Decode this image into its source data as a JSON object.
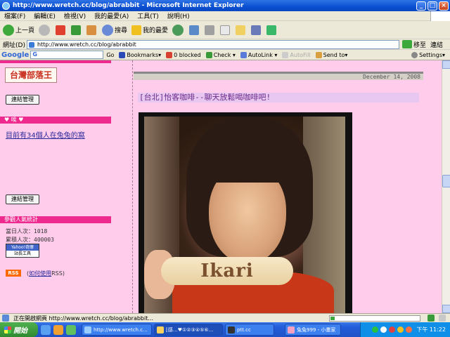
{
  "window": {
    "title": "http://www.wretch.cc/blog/abrabbit - Microsoft Internet Explorer",
    "min": "_",
    "max": "□",
    "close": "×"
  },
  "menu": [
    "檔案(F)",
    "編輯(E)",
    "檢視(V)",
    "我的最愛(A)",
    "工具(T)",
    "說明(H)"
  ],
  "toolbar": {
    "back": "上一頁",
    "search": "搜尋",
    "favorites": "我的最愛"
  },
  "address": {
    "label": "網址(D)",
    "url": "http://www.wretch.cc/blog/abrabbit",
    "go": "移至",
    "links": "連結"
  },
  "googlebar": {
    "logo": "Google",
    "search_placeholder": "G",
    "go": "Go",
    "bookmarks": "Bookmarks▾",
    "blocked": "0 blocked",
    "check": "Check ▾",
    "autolink": "AutoLink ▾",
    "autofill": "AutoFill",
    "sendto": "Send to▾",
    "settings": "Settings▾"
  },
  "sidebar": {
    "logo": "台灣部落王",
    "btn1": "連結管理",
    "header_visitors": "♥ 唉 ♥",
    "online_link": "目前有34個人在兔兔的窩",
    "btn2": "連結管理",
    "header_stats": "參觀人氣統計",
    "today_label": "當日人次：",
    "today_value": "1018",
    "total_label": "累積人次：",
    "total_value": "400003",
    "yahoo_top": "Yahoo!奇摩",
    "yahoo_bottom": "站長工具",
    "rss": "RSS",
    "rss_link_open": "(",
    "rss_link_text": "如何使用",
    "rss_link_close": "RSS)"
  },
  "content": {
    "date": "December 14, 2008",
    "post_title": "[台北]怡客咖啡--聊天放鬆喝咖啡吧!",
    "photo_text": "Ikari"
  },
  "status": {
    "text": "正在開啟網頁 http://www.wretch.cc/blog/abrabbit...",
    "progress": 0.05
  },
  "taskbar": {
    "start": "開始",
    "tasks": [
      "http://www.wretch.c...",
      "[感…♥①②③④⑤⑥...",
      "ptt.cc",
      "兔兔999 - 小畫家"
    ],
    "clock": "下午 11:22"
  }
}
